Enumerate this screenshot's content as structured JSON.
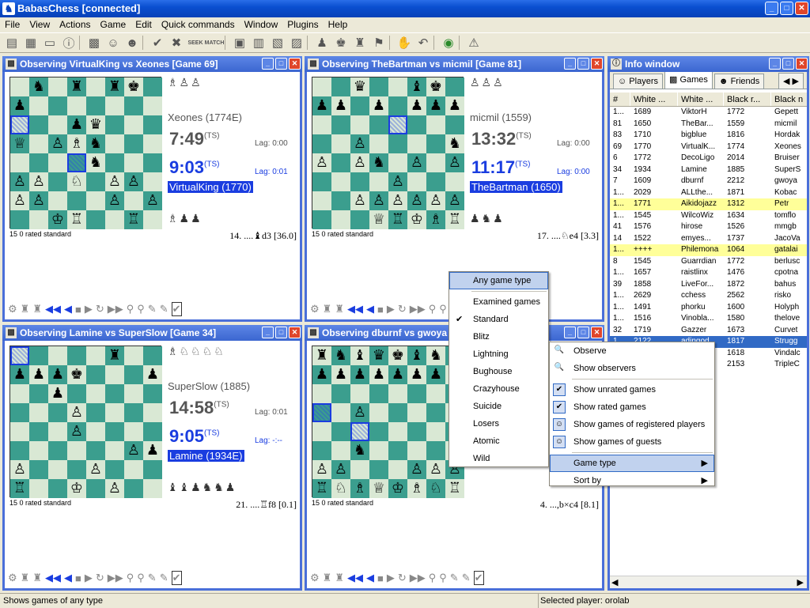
{
  "app": {
    "title": "BabasChess [connected]",
    "icon": "chess-knight-icon"
  },
  "menu": [
    "File",
    "View",
    "Actions",
    "Game",
    "Edit",
    "Quick commands",
    "Window",
    "Plugins",
    "Help"
  ],
  "toolbar": {
    "seek": "SEEK",
    "match": "MATCH"
  },
  "windows": [
    {
      "title": "Observing VirtualKing vs Xeones [Game 69]",
      "top_caps": "♗♙♙",
      "bottom_caps": "♗♟♟",
      "top_player": "Xeones (1774E)",
      "top_clock": "7:49",
      "top_lag": "Lag: 0:00",
      "bottom_clock": "9:03",
      "bottom_lag": "Lag: 0:01",
      "bottom_player": "VirtualKing (1770)",
      "ts": "(TS)",
      "gametype": "15 0 rated standard",
      "move": "14. ....♝d3 [36.0]",
      "board": [
        "·♞·♜·♜♚·",
        "♟·······",
        "▣··♟♛···",
        "♕·♙♗♞···",
        "···▣♞···",
        "♙♙·♘·♙♙·",
        "♙♙···♙·♙",
        "··♔♖··♖·"
      ]
    },
    {
      "title": "Observing TheBartman vs micmil [Game 81]",
      "top_caps": "♙♙♙",
      "bottom_caps": "♟♞♟",
      "top_player": "micmil (1559)",
      "top_clock": "13:32",
      "top_lag": "Lag: 0:00",
      "bottom_clock": "11:17",
      "bottom_lag": "Lag: 0:00",
      "bottom_player": "TheBartman (1650)",
      "ts": "(TS)",
      "gametype": "15 0 rated standard",
      "move": "17. ....♘e4 [3.3]",
      "board": [
        "··♛··♝♚·",
        "♟♟·♟·♟♟♟",
        "····▣···",
        "··♙····♞",
        "♙·♙♞·♙·♙",
        "····♙···",
        "··♙♙♙♙♙♙",
        "···♕♖♔♗♖"
      ]
    },
    {
      "title": "Observing Lamine vs SuperSlow [Game 34]",
      "top_caps": "♗♘♘♘♘",
      "bottom_caps": "♝♝♟♞♞♟",
      "top_player": "SuperSlow (1885)",
      "top_clock": "14:58",
      "top_lag": "Lag: 0:01",
      "bottom_clock": "9:05",
      "bottom_lag": "Lag: -:--",
      "bottom_player": "Lamine (1934E)",
      "ts": "(TS)",
      "gametype": "15 0 rated standard",
      "move": "21. ....♖f8 [0.1]",
      "board": [
        "▣····♜··",
        "♟♟♟♚···♟",
        "··♟·····",
        "···♙····",
        "···♙····",
        "······♙♟",
        "♙···♙···",
        "♖··♔·♙··"
      ]
    },
    {
      "title": "Observing dburnf vs gwoya",
      "gametype": "15 0 rated standard",
      "move": "4. ...,b×c4 [8.1]",
      "board": [
        "♜♞♝♛♚♝♞♜",
        "♟♟♟♟♟♟♟♟",
        "········",
        "▣·♙·····",
        "··▣·····",
        "··♞·····",
        "♙♙···♙♙♙",
        "♖♘♗♕♔♗♘♖"
      ]
    }
  ],
  "info": {
    "title": "Info window",
    "tabs": [
      "Players",
      "Games",
      "Friends"
    ],
    "columns": [
      "#",
      "White ...",
      "White ...",
      "Black r...",
      "Black n"
    ],
    "rows": [
      [
        "1...",
        "1689",
        "ViktorH",
        "1772",
        "Gepett"
      ],
      [
        "81",
        "1650",
        "TheBar...",
        "1559",
        "micmil"
      ],
      [
        "83",
        "1710",
        "bigblue",
        "1816",
        "Hordak"
      ],
      [
        "69",
        "1770",
        "VirtualK...",
        "1774",
        "Xeones"
      ],
      [
        "6",
        "1772",
        "DecoLigo",
        "2014",
        "Bruiser"
      ],
      [
        "34",
        "1934",
        "Lamine",
        "1885",
        "SuperS"
      ],
      [
        "7",
        "1609",
        "dburnf",
        "2212",
        "gwoya"
      ],
      [
        "1...",
        "2029",
        "ALLthe...",
        "1871",
        "Kobac"
      ],
      [
        "1...",
        "1771",
        "Aikidojazz",
        "1312",
        "Petr"
      ],
      [
        "1...",
        "1545",
        "WilcoWiz",
        "1634",
        "tomflo"
      ],
      [
        "41",
        "1576",
        "hirose",
        "1526",
        "mmgb"
      ],
      [
        "14",
        "1522",
        "emyes...",
        "1737",
        "JacoVa"
      ],
      [
        "1...",
        "++++",
        "Philemona",
        "1064",
        "gatalai"
      ],
      [
        "8",
        "1545",
        "Guarrdian",
        "1772",
        "berlusc"
      ],
      [
        "1...",
        "1657",
        "raistlinx",
        "1476",
        "cpotna"
      ],
      [
        "39",
        "1858",
        "LiveFor...",
        "1872",
        "bahus"
      ],
      [
        "1...",
        "2629",
        "cchess",
        "2562",
        "risko"
      ],
      [
        "1...",
        "1491",
        "phorku",
        "1600",
        "Holyph"
      ],
      [
        "1...",
        "1516",
        "Vinobla...",
        "1580",
        "thelove"
      ],
      [
        "32",
        "1719",
        "Gazzer",
        "1673",
        "Curvet"
      ],
      [
        "1...",
        "2122",
        "adingod",
        "1817",
        "Strugg"
      ],
      [
        "",
        "",
        "",
        "1618",
        "Vindalc"
      ],
      [
        "",
        "",
        "",
        "2153",
        "TripleC"
      ]
    ]
  },
  "game_type_menu": [
    "Any game type",
    "Examined games",
    "Standard",
    "Blitz",
    "Lightning",
    "Bughouse",
    "Crazyhouse",
    "Suicide",
    "Losers",
    "Atomic",
    "Wild"
  ],
  "context_menu": [
    "Observe",
    "Show observers",
    "Show unrated games",
    "Show rated games",
    "Show games of registered players",
    "Show games of guests",
    "Game type",
    "Sort by"
  ],
  "status": {
    "left": "Shows games of any type",
    "right": "Selected player: orolab"
  }
}
